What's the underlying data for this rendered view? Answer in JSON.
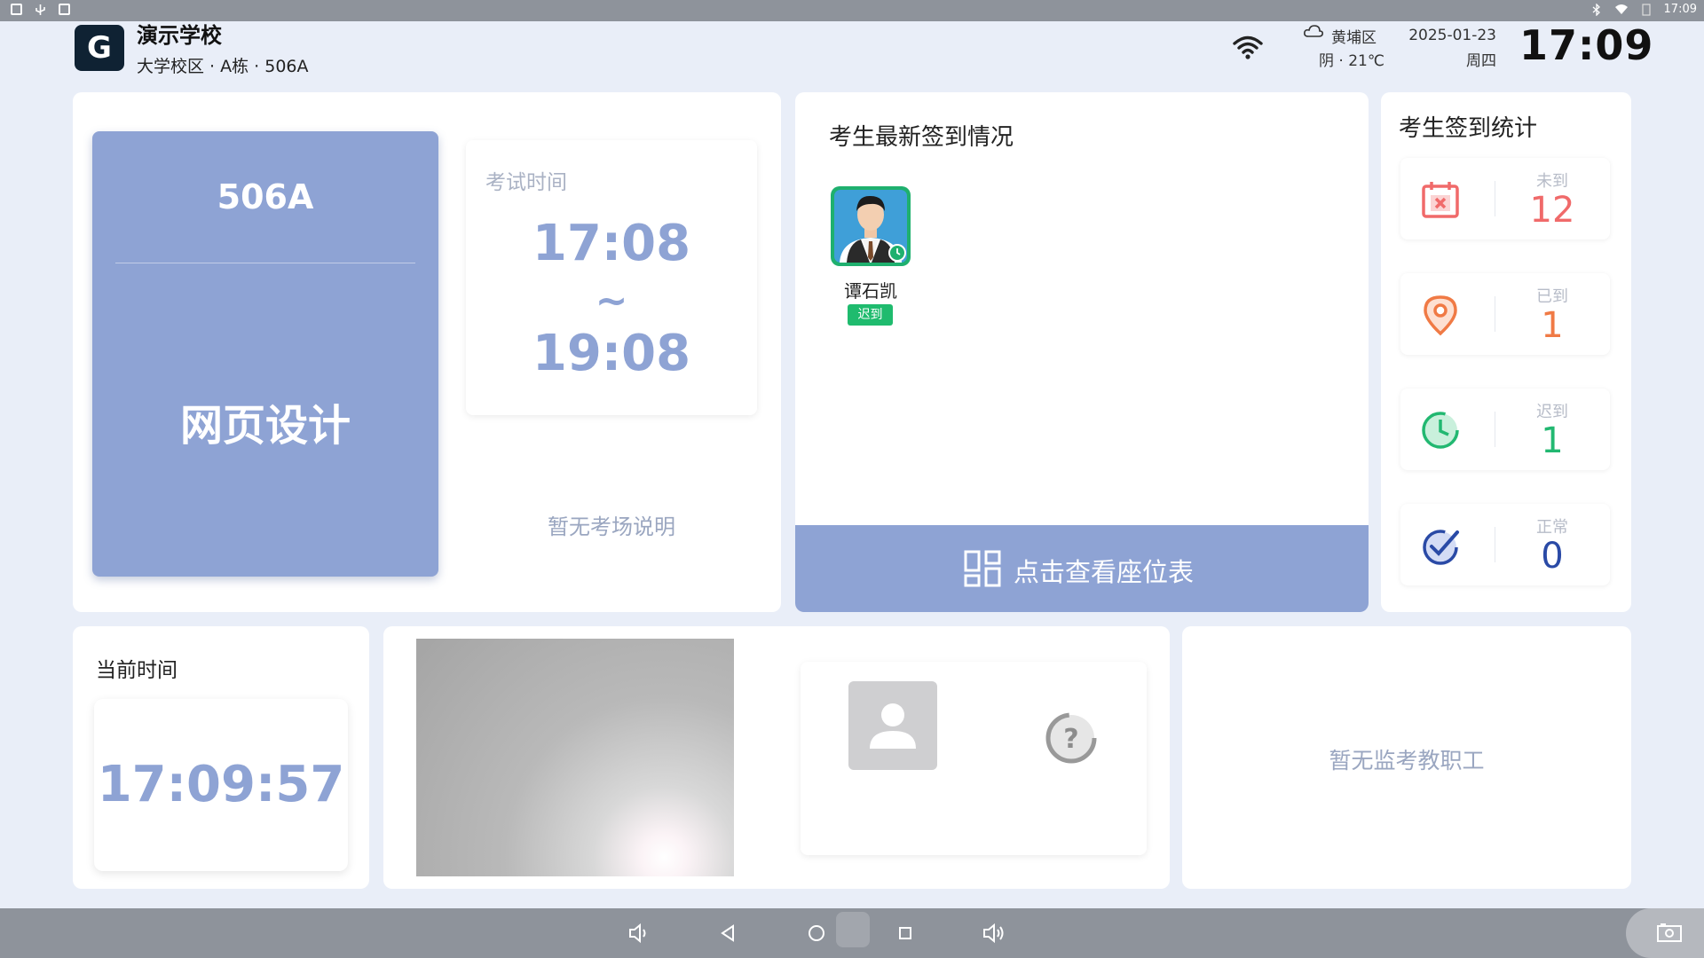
{
  "status_bar": {
    "time": "17:09"
  },
  "header": {
    "logo_letter": "G",
    "school_name": "演示学校",
    "school_location": "大学校区 · A栋 · 506A",
    "district": "黄埔区",
    "weather": "阴 · 21℃",
    "date": "2025-01-23",
    "weekday": "周四",
    "clock": "17:09"
  },
  "room": {
    "code": "506A",
    "subject": "网页设计",
    "exam_time_label": "考试时间",
    "exam_start": "17:08",
    "exam_tilde": "~",
    "exam_end": "19:08",
    "room_note": "暂无考场说明"
  },
  "checkin": {
    "title": "考生最新签到情况",
    "students": [
      {
        "name": "谭石凯",
        "status": "迟到"
      }
    ],
    "seat_button_label": "点击查看座位表"
  },
  "stats": {
    "title": "考生签到统计",
    "items": [
      {
        "label": "未到",
        "value": "12",
        "color": "#f06a6a",
        "icon": "calendar-x-icon"
      },
      {
        "label": "已到",
        "value": "1",
        "color": "#f07a45",
        "icon": "location-pin-icon"
      },
      {
        "label": "迟到",
        "value": "1",
        "color": "#22b871",
        "icon": "timer-icon"
      },
      {
        "label": "正常",
        "value": "0",
        "color": "#2a4aa6",
        "icon": "check-badge-icon"
      }
    ]
  },
  "current_time": {
    "label": "当前时间",
    "value": "17:09:57"
  },
  "invigilator": {
    "empty_text": "暂无监考教职工"
  },
  "colors": {
    "accent": "#8ea3d4",
    "background": "#e9eef8",
    "late_badge": "#1fbb6e"
  }
}
